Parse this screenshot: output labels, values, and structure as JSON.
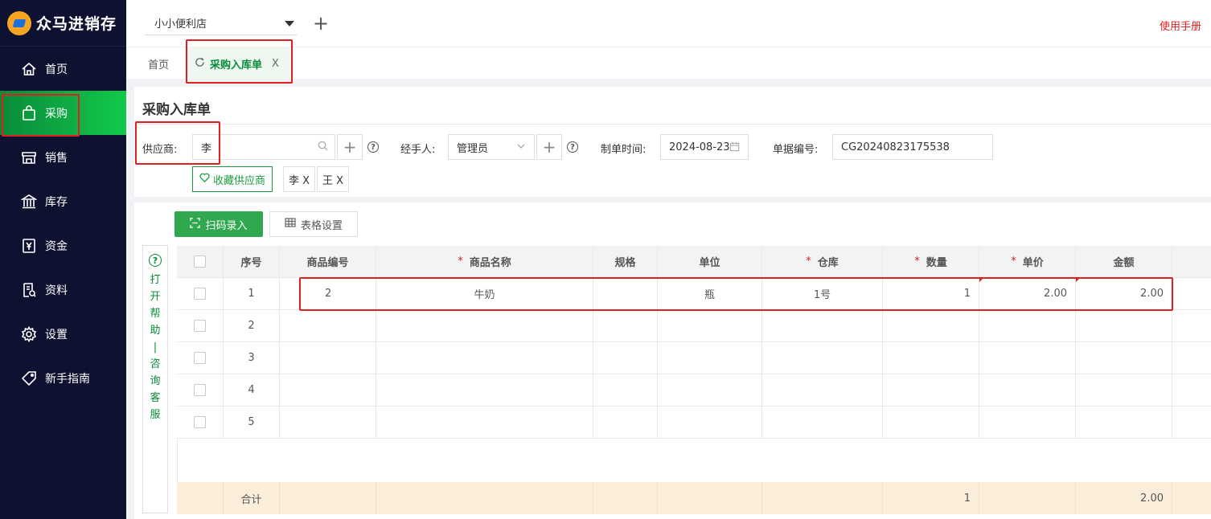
{
  "app": {
    "name": "众马进销存"
  },
  "sidebar": {
    "items": [
      {
        "label": "首页",
        "icon": "home-icon"
      },
      {
        "label": "采购",
        "icon": "shopping-bag-icon",
        "active": true
      },
      {
        "label": "销售",
        "icon": "store-icon"
      },
      {
        "label": "库存",
        "icon": "warehouse-icon"
      },
      {
        "label": "资金",
        "icon": "yuan-icon"
      },
      {
        "label": "资料",
        "icon": "document-icon"
      },
      {
        "label": "设置",
        "icon": "gear-icon"
      },
      {
        "label": "新手指南",
        "icon": "tag-icon"
      }
    ]
  },
  "topbar": {
    "store": "小小便利店",
    "manual": "使用手册"
  },
  "tabs": {
    "home": "首页",
    "active": "采购入库单",
    "close": "X"
  },
  "form": {
    "title": "采购入库单",
    "supplier_label": "供应商:",
    "supplier_value": "李",
    "handler_label": "经手人:",
    "handler_value": "管理员",
    "date_label": "制单时间:",
    "date_value": "2024-08-23",
    "docno_label": "单据编号:",
    "docno_value": "CG20240823175538",
    "fav_label": "收藏供应商",
    "chips": [
      "李 X",
      "王 X"
    ]
  },
  "toolbar": {
    "scan": "扫码录入",
    "table_settings": "表格设置"
  },
  "help_side": {
    "chars": [
      "打",
      "开",
      "帮",
      "助",
      "|",
      "咨",
      "询",
      "客",
      "服"
    ]
  },
  "table": {
    "headers": {
      "index": "序号",
      "code": "商品编号",
      "name": "商品名称",
      "spec": "规格",
      "unit": "单位",
      "warehouse": "仓库",
      "qty": "数量",
      "price": "单价",
      "amount": "金额"
    },
    "required_mark": "*",
    "rows": [
      {
        "index": "1",
        "code": "2",
        "name": "牛奶",
        "spec": "",
        "unit": "瓶",
        "warehouse": "1号",
        "qty": "1",
        "price": "2.00",
        "amount": "2.00"
      },
      {
        "index": "2",
        "code": "",
        "name": "",
        "spec": "",
        "unit": "",
        "warehouse": "",
        "qty": "",
        "price": "",
        "amount": ""
      },
      {
        "index": "3",
        "code": "",
        "name": "",
        "spec": "",
        "unit": "",
        "warehouse": "",
        "qty": "",
        "price": "",
        "amount": ""
      },
      {
        "index": "4",
        "code": "",
        "name": "",
        "spec": "",
        "unit": "",
        "warehouse": "",
        "qty": "",
        "price": "",
        "amount": ""
      },
      {
        "index": "5",
        "code": "",
        "name": "",
        "spec": "",
        "unit": "",
        "warehouse": "",
        "qty": "",
        "price": "",
        "amount": ""
      }
    ],
    "summary": {
      "label": "合计",
      "qty": "1",
      "amount": "2.00"
    }
  },
  "colors": {
    "sidebar_bg": "#0e1130",
    "accent_green": "#2fa84f",
    "highlight_red": "#e02020"
  }
}
